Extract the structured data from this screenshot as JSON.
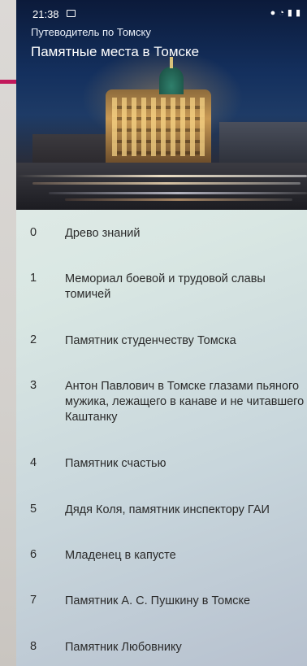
{
  "status_bar": {
    "time": "21:38",
    "left_icon": "image-icon",
    "right_icons": [
      "location-icon",
      "wifi-icon",
      "signal-icon",
      "battery-icon"
    ]
  },
  "header": {
    "subtitle": "Путеводитель по Томску",
    "title": "Памятные места в Томске"
  },
  "colors": {
    "accent": "#c2185b",
    "text": "#2a2a2a",
    "header_text": "#ffffff"
  },
  "list": {
    "items": [
      {
        "index": "0",
        "label": "Древо знаний"
      },
      {
        "index": "1",
        "label": "Мемориал боевой и трудовой славы томичей"
      },
      {
        "index": "2",
        "label": "Памятник студенчеству Томска"
      },
      {
        "index": "3",
        "label": "Антон Павлович в Томске глазами пьяного мужика, лежащего в канаве и не читавшего Каштанку"
      },
      {
        "index": "4",
        "label": "Памятник счастью"
      },
      {
        "index": "5",
        "label": "Дядя Коля, памятник инспектору ГАИ"
      },
      {
        "index": "6",
        "label": "Младенец в капусте"
      },
      {
        "index": "7",
        "label": "Памятник А. С. Пушкину в Томске"
      },
      {
        "index": "8",
        "label": "Памятник Любовнику"
      }
    ]
  }
}
